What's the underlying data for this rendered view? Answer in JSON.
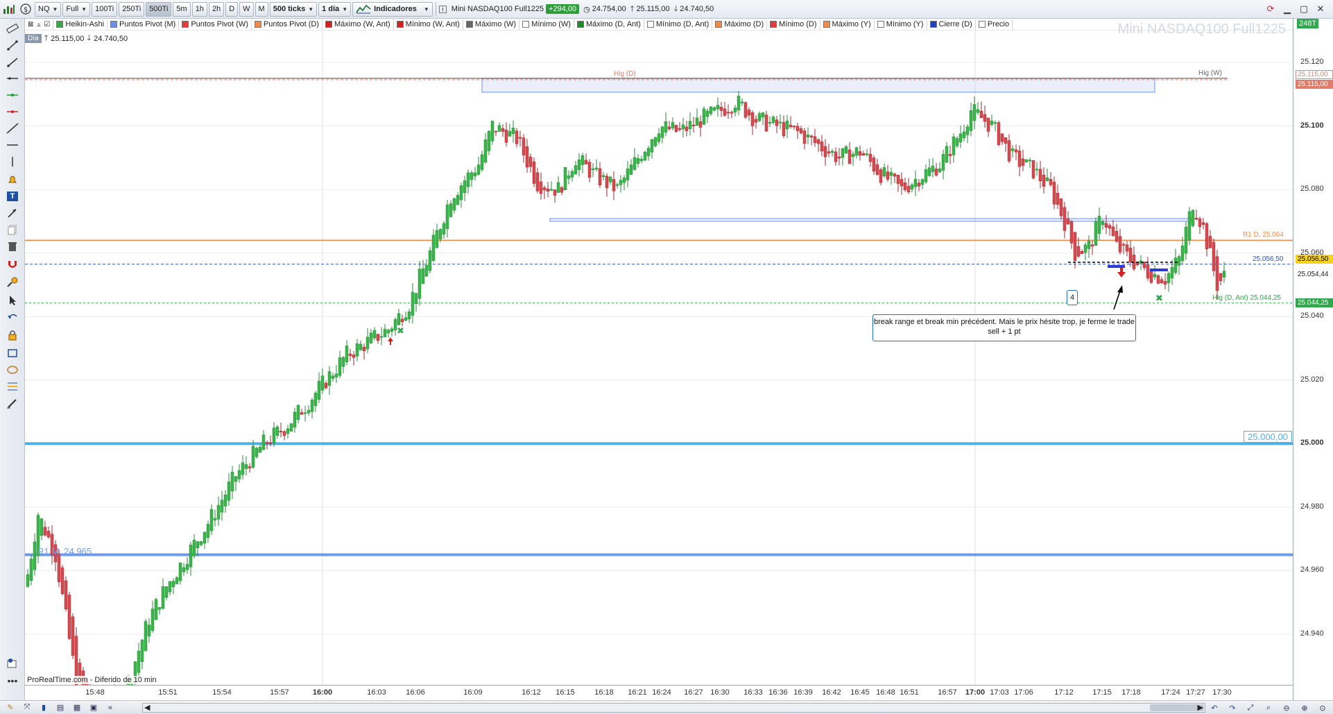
{
  "toolbar": {
    "symbol": "NQ",
    "mode": "Full",
    "tick_buttons": [
      "100Ti",
      "250Ti",
      "500Ti"
    ],
    "active_tick": "500Ti",
    "timeframes": [
      "5m",
      "1h",
      "2h",
      "D",
      "W",
      "M"
    ],
    "ticks_select": "500 ticks",
    "period_select": "1 día",
    "indicators_label": "Indicadores",
    "instrument": "Mini NASDAQ100 Full1225",
    "change": "+294,00",
    "close_value": "24.754,00",
    "high_value": "25.115,00",
    "low_value": "24.740,50"
  },
  "legend": [
    {
      "label": "Heikin-Ashi",
      "color": "#3aa84a"
    },
    {
      "label": "Puntos Pivot (M)",
      "color": "#6b8fe6"
    },
    {
      "label": "Puntos Pivot (W)",
      "color": "#e23b3b"
    },
    {
      "label": "Puntos Pivot (D)",
      "color": "#f08a4b"
    },
    {
      "label": "Máximo (W, Ant)",
      "color": "#d42020"
    },
    {
      "label": "Mínimo (W, Ant)",
      "color": "#d42020"
    },
    {
      "label": "Máximo (W)",
      "color": "#666666"
    },
    {
      "label": "Mínimo (W)",
      "color": "#ffffff"
    },
    {
      "label": "Máximo (D, Ant)",
      "color": "#1f8a2a"
    },
    {
      "label": "Mínimo (D, Ant)",
      "color": "#ffffff"
    },
    {
      "label": "Máximo (D)",
      "color": "#f08a4b"
    },
    {
      "label": "Mínimo (D)",
      "color": "#e23b3b"
    },
    {
      "label": "Máximo (Y)",
      "color": "#f08a4b"
    },
    {
      "label": "Mínimo (Y)",
      "color": "#ffffff"
    },
    {
      "label": "Cierre (D)",
      "color": "#2040c0"
    },
    {
      "label": "Precio",
      "color": "#ffffff"
    }
  ],
  "ohlc_header": {
    "badge": "Día",
    "high": "25.115,00",
    "low": "24.740,50"
  },
  "watermark": "Mini NASDAQ100 Full1225",
  "top_right_tag": "248T",
  "price_axis": {
    "ticks": [
      "25.120",
      "25.100",
      "25.080",
      "25.060",
      "25.040",
      "25.020",
      "25.000",
      "24.980",
      "24.960",
      "24.940"
    ],
    "major_ticks": [
      "25.100",
      "25.000"
    ],
    "boxes": [
      {
        "text": "25.115,00",
        "color": "#d08a7a"
      },
      {
        "text": "25.115,00",
        "color": "#ffffff",
        "bg": "#e07d6a"
      },
      {
        "text": "25.056,50",
        "color": "#000000",
        "bg": "#f5d21f"
      },
      {
        "text": "25.054,44",
        "color": "#222222",
        "bg": "#ffffff"
      },
      {
        "text": "25.044,25",
        "color": "#ffffff",
        "bg": "#2ea84a"
      }
    ]
  },
  "time_axis": {
    "labels": [
      "15:48",
      "15:51",
      "15:54",
      "15:57",
      "16:00",
      "16:03",
      "16:06",
      "16:09",
      "16:12",
      "16:15",
      "16:18",
      "16:21",
      "16:24",
      "16:27",
      "16:30",
      "16:33",
      "16:36",
      "16:39",
      "16:42",
      "16:45",
      "16:48",
      "16:51",
      "16:57",
      "17:00",
      "17:03",
      "17:06",
      "17:12",
      "17:15",
      "17:18",
      "17:24",
      "17:27",
      "17:30"
    ],
    "major": [
      "16:00",
      "17:00"
    ]
  },
  "chart_labels": {
    "hig_d": "Hig (D)",
    "hig_w": "Hig (W)",
    "r1_d": "R1 D, 25.064",
    "price_line": "25.056,50",
    "hig_d_ant": "Hig (D, Ant) 25.044,25",
    "r1_m": "R1 M, 24.965",
    "level_25000": "25.000,00"
  },
  "annotation": {
    "line1": "break range et break min précédent. Mais le prix hésite trop, je ferme le trade",
    "line2": "sell + 1 pt",
    "marker": "4"
  },
  "footer_credit": "ProRealTime.com - Diferido de 10 min",
  "chart_data": {
    "type": "candlestick",
    "style": "Heikin-Ashi",
    "title": "Mini NASDAQ100 Full1225",
    "ylim": [
      24930,
      25125
    ],
    "levels": [
      {
        "name": "Hig (D)",
        "value": 25115.0
      },
      {
        "name": "R1 D",
        "value": 25064
      },
      {
        "name": "Precio",
        "value": 25056.5
      },
      {
        "name": "Hig (D, Ant)",
        "value": 25044.25
      },
      {
        "name": "Máximo (W)",
        "value": 25000
      },
      {
        "name": "R1 M",
        "value": 24965
      }
    ],
    "day_high": 25115.0,
    "day_low": 24740.5,
    "last": 25054.44
  }
}
